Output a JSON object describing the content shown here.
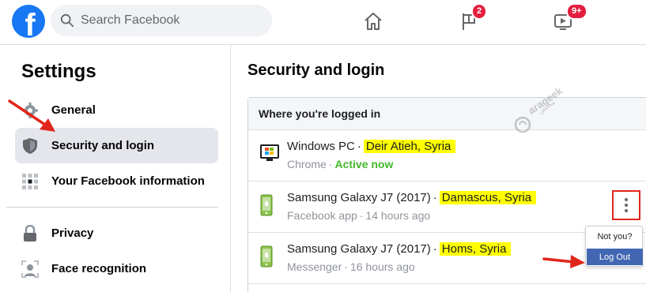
{
  "topbar": {
    "logo_letter": "f",
    "search_placeholder": "Search Facebook",
    "flag_badge": "2",
    "watch_badge": "9+"
  },
  "sidebar": {
    "title": "Settings",
    "items": [
      {
        "label": "General",
        "icon": "gear-icon"
      },
      {
        "label": "Security and login",
        "icon": "shield-icon",
        "active": true
      },
      {
        "label": "Your Facebook information",
        "icon": "grid-icon"
      },
      {
        "label": "Privacy",
        "icon": "lock-icon"
      },
      {
        "label": "Face recognition",
        "icon": "face-icon"
      }
    ]
  },
  "main": {
    "title": "Security and login",
    "section_header": "Where you're logged in",
    "sessions": [
      {
        "device": "Windows PC",
        "location": "Deir Atieh, Syria",
        "app": "Chrome",
        "time": "Active now"
      },
      {
        "device": "Samsung Galaxy J7 (2017)",
        "location": "Damascus, Syria",
        "app": "Facebook app",
        "time": "14 hours ago"
      },
      {
        "device": "Samsung Galaxy J7 (2017)",
        "location": "Homs, Syria",
        "app": "Messenger",
        "time": "16 hours ago"
      }
    ],
    "separator": "·"
  },
  "popup": {
    "not_you": "Not you?",
    "logout": "Log Out"
  },
  "watermark": {
    "text": "arageek",
    "subtext": "مختص"
  },
  "colors": {
    "brand": "#1877f2",
    "highlight": "#ffff00",
    "active_green": "#42b72a",
    "annotation_red": "#e0261b",
    "logout_blue": "#4267b2"
  }
}
